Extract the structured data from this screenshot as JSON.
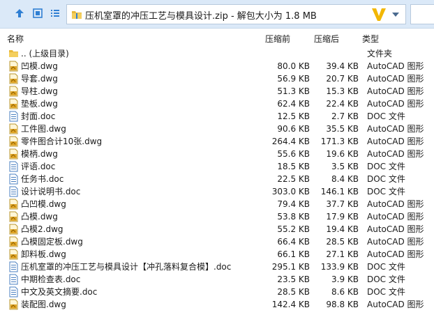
{
  "address": {
    "path_text": "压机室罩的冲压工艺与模具设计.zip - 解包大小为 1.8 MB"
  },
  "columns": {
    "name": "名称",
    "compressed": "压缩前",
    "original": "压缩后",
    "type": "类型"
  },
  "rows": [
    {
      "icon": "folder-icon",
      "name": ".. (上级目录)",
      "comp": "",
      "orig": "",
      "type": "文件夹"
    },
    {
      "icon": "dwg-file-icon",
      "name": "凹模.dwg",
      "comp": "80.0 KB",
      "orig": "39.4 KB",
      "type": "AutoCAD 图形"
    },
    {
      "icon": "dwg-file-icon",
      "name": "导套.dwg",
      "comp": "56.9 KB",
      "orig": "20.7 KB",
      "type": "AutoCAD 图形"
    },
    {
      "icon": "dwg-file-icon",
      "name": "导柱.dwg",
      "comp": "51.3 KB",
      "orig": "15.3 KB",
      "type": "AutoCAD 图形"
    },
    {
      "icon": "dwg-file-icon",
      "name": "垫板.dwg",
      "comp": "62.4 KB",
      "orig": "22.4 KB",
      "type": "AutoCAD 图形"
    },
    {
      "icon": "doc-file-icon",
      "name": "封面.doc",
      "comp": "12.5 KB",
      "orig": "2.7 KB",
      "type": "DOC 文件"
    },
    {
      "icon": "dwg-file-icon",
      "name": "工件图.dwg",
      "comp": "90.6 KB",
      "orig": "35.5 KB",
      "type": "AutoCAD 图形"
    },
    {
      "icon": "dwg-file-icon",
      "name": "零件图合计10张.dwg",
      "comp": "264.4 KB",
      "orig": "171.3 KB",
      "type": "AutoCAD 图形"
    },
    {
      "icon": "dwg-file-icon",
      "name": "模柄.dwg",
      "comp": "55.6 KB",
      "orig": "19.6 KB",
      "type": "AutoCAD 图形"
    },
    {
      "icon": "doc-file-icon",
      "name": "评语.doc",
      "comp": "18.5 KB",
      "orig": "3.5 KB",
      "type": "DOC 文件"
    },
    {
      "icon": "doc-file-icon",
      "name": "任务书.doc",
      "comp": "22.5 KB",
      "orig": "8.4 KB",
      "type": "DOC 文件"
    },
    {
      "icon": "doc-file-icon",
      "name": "设计说明书.doc",
      "comp": "303.0 KB",
      "orig": "146.1 KB",
      "type": "DOC 文件"
    },
    {
      "icon": "dwg-file-icon",
      "name": "凸凹模.dwg",
      "comp": "79.4 KB",
      "orig": "37.7 KB",
      "type": "AutoCAD 图形"
    },
    {
      "icon": "dwg-file-icon",
      "name": "凸模.dwg",
      "comp": "53.8 KB",
      "orig": "17.9 KB",
      "type": "AutoCAD 图形"
    },
    {
      "icon": "dwg-file-icon",
      "name": "凸模2.dwg",
      "comp": "55.2 KB",
      "orig": "19.4 KB",
      "type": "AutoCAD 图形"
    },
    {
      "icon": "dwg-file-icon",
      "name": "凸模固定板.dwg",
      "comp": "66.4 KB",
      "orig": "28.5 KB",
      "type": "AutoCAD 图形"
    },
    {
      "icon": "dwg-file-icon",
      "name": "卸料板.dwg",
      "comp": "66.1 KB",
      "orig": "27.1 KB",
      "type": "AutoCAD 图形"
    },
    {
      "icon": "doc-file-icon",
      "name": "压机室罩的冲压工艺与模具设计【冲孔落料复合模】.doc",
      "comp": "295.1 KB",
      "orig": "133.9 KB",
      "type": "DOC 文件"
    },
    {
      "icon": "doc-file-icon",
      "name": "中期检查表.doc",
      "comp": "23.5 KB",
      "orig": "3.9 KB",
      "type": "DOC 文件"
    },
    {
      "icon": "doc-file-icon",
      "name": "中文及英文摘要.doc",
      "comp": "28.5 KB",
      "orig": "8.6 KB",
      "type": "DOC 文件"
    },
    {
      "icon": "dwg-file-icon",
      "name": "装配图.dwg",
      "comp": "142.4 KB",
      "orig": "98.8 KB",
      "type": "AutoCAD 图形"
    }
  ],
  "colors": {
    "toolbar_bg": "#dbe9f8",
    "accent_blue": "#2f7fd3",
    "folder_yellow": "#e8b83a",
    "logo_yellow": "#f2b705"
  }
}
